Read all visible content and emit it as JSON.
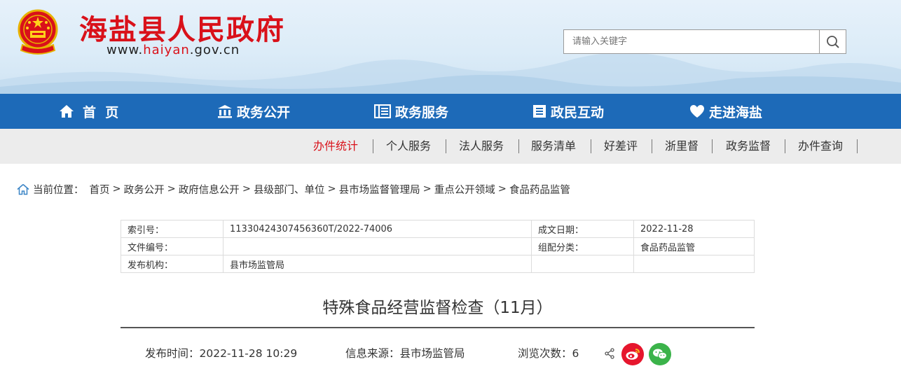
{
  "header": {
    "site_title": "海盐县人民政府",
    "site_url_prefix": "www.",
    "site_url_highlight": "haiyan",
    "site_url_suffix": ".gov.cn",
    "search_placeholder": "请输入关键字"
  },
  "main_nav": [
    {
      "label": "首  页",
      "icon": "home-icon"
    },
    {
      "label": "政务公开",
      "icon": "government-building-icon"
    },
    {
      "label": "政务服务",
      "icon": "service-list-icon"
    },
    {
      "label": "政民互动",
      "icon": "document-list-icon"
    },
    {
      "label": "走进海盐",
      "icon": "heart-icon"
    }
  ],
  "sub_nav": [
    {
      "label": "办件统计",
      "active": true
    },
    {
      "label": "个人服务"
    },
    {
      "label": "法人服务"
    },
    {
      "label": "服务清单"
    },
    {
      "label": "好差评"
    },
    {
      "label": "浙里督"
    },
    {
      "label": "政务监督"
    },
    {
      "label": "办件查询"
    }
  ],
  "breadcrumb": {
    "prefix": "当前位置：",
    "items": [
      "首页",
      "政务公开",
      "政府信息公开",
      "县级部门、单位",
      "县市场监督管理局",
      "重点公开领域",
      "食品药品监管"
    ],
    "separator": ">"
  },
  "meta": {
    "index_label": "索引号：",
    "index_value": "11330424307456360T/2022-74006",
    "date_label": "成文日期：",
    "date_value": "2022-11-28",
    "docno_label": "文件编号：",
    "docno_value": "",
    "category_label": "组配分类：",
    "category_value": "食品药品监管",
    "org_label": "发布机构：",
    "org_value": "县市场监管局"
  },
  "article": {
    "title": "特殊食品经营监督检查（11月）",
    "publish_time": "发布时间：2022-11-28 10:29",
    "source": "信息来源：县市场监管局",
    "views": "浏览次数：6"
  },
  "colors": {
    "brand_red": "#d9111a",
    "nav_blue": "#1d6ab8",
    "weibo_red": "#e6162d",
    "wechat_green": "#3bb34a"
  }
}
